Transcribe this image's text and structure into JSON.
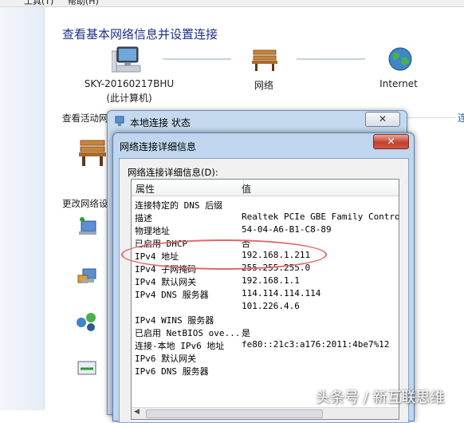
{
  "menubar": {
    "tools": "工具(T)",
    "help": "帮助(H)"
  },
  "control_panel": {
    "title": "查看基本网络信息并设置连接",
    "computer": {
      "name": "SKY-20160217BHU",
      "caption": "(此计算机)"
    },
    "network_label": "网络",
    "internet_label": "Internet",
    "active_networks_label": "查看活动网",
    "change_settings_label": "更改网络设",
    "partial_link": "连"
  },
  "status_window": {
    "title": "本地连接 状态",
    "close_label": "✕"
  },
  "details_window": {
    "title": "网络连接详细信息",
    "close_label": "✕",
    "section_label": "网络连接详细信息(D):",
    "columns": {
      "property": "属性",
      "value": "值"
    },
    "rows": [
      {
        "property": "连接特定的 DNS 后缀",
        "value": ""
      },
      {
        "property": "描述",
        "value": "Realtek PCIe GBE Family Controller"
      },
      {
        "property": "物理地址",
        "value": "54-04-A6-B1-C8-89"
      },
      {
        "property": "已启用 DHCP",
        "value": "否"
      },
      {
        "property": "IPv4 地址",
        "value": "192.168.1.211"
      },
      {
        "property": "IPv4 子网掩码",
        "value": "255.255.255.0"
      },
      {
        "property": "IPv4 默认网关",
        "value": "192.168.1.1"
      },
      {
        "property": "IPv4 DNS 服务器",
        "value": "114.114.114.114"
      },
      {
        "property": "",
        "value": "101.226.4.6"
      },
      {
        "property": "IPv4 WINS 服务器",
        "value": ""
      },
      {
        "property": "已启用 NetBIOS ove...",
        "value": "是"
      },
      {
        "property": "连接-本地 IPv6 地址",
        "value": "fe80::21c3:a176:2011:4be7%12"
      },
      {
        "property": "IPv6 默认网关",
        "value": ""
      },
      {
        "property": "IPv6 DNS 服务器",
        "value": ""
      }
    ]
  },
  "watermark": "头条号 / 新互联思维",
  "colors": {
    "annotation": "#e06767",
    "title_blue": "#1e3287",
    "window_frame": "#bfd6ee"
  }
}
